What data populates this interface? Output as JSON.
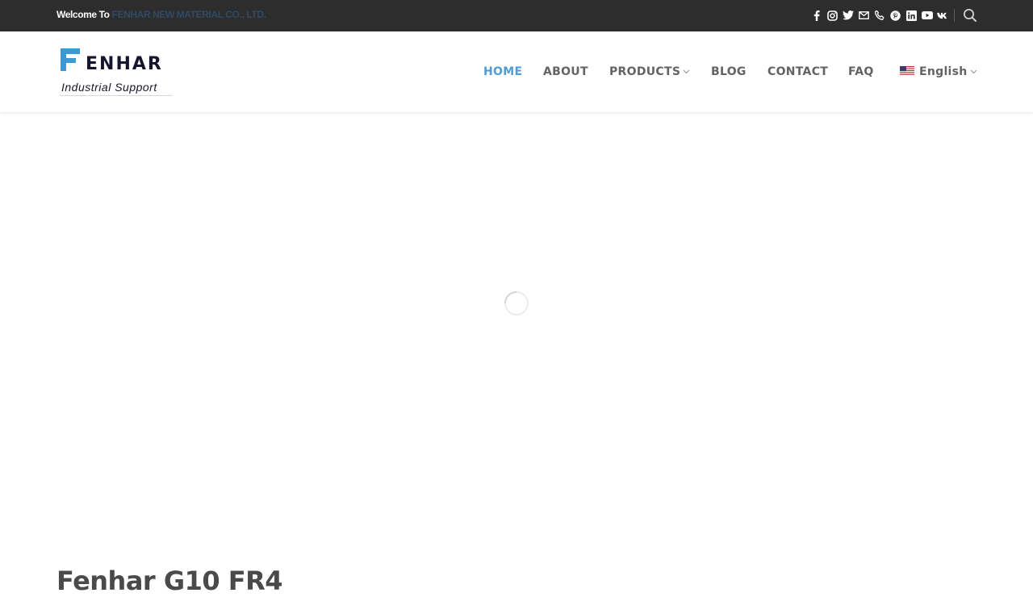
{
  "topbar": {
    "welcome_text": "Welcome To",
    "company_link": "FENHAR NEW MATERIAL CO., LTD.",
    "social_icons": [
      "facebook-icon",
      "instagram-icon",
      "twitter-icon",
      "email-icon",
      "phone-icon",
      "pinterest-icon",
      "linkedin-icon",
      "youtube-icon",
      "vk-icon"
    ],
    "search_icon": "search-icon"
  },
  "logo": {
    "wordmark": "ENHAR",
    "tagline": "Industrial Support"
  },
  "nav": {
    "items": [
      {
        "label": "HOME",
        "active": true
      },
      {
        "label": "ABOUT",
        "active": false
      },
      {
        "label": "PRODUCTS",
        "active": false,
        "has_dropdown": true
      },
      {
        "label": "BLOG",
        "active": false
      },
      {
        "label": "CONTACT",
        "active": false
      },
      {
        "label": "FAQ",
        "active": false
      }
    ],
    "language": {
      "label": "English",
      "flag": "us-flag-icon"
    }
  },
  "main": {
    "loading": true,
    "product_title": "Fenhar G10 FR4"
  },
  "colors": {
    "topbar_bg": "#2d2d2d",
    "accent": "#4f9dd0",
    "nav_text": "#636363",
    "logo_blue": "#3b9ad6",
    "logo_dark": "#15152d"
  }
}
